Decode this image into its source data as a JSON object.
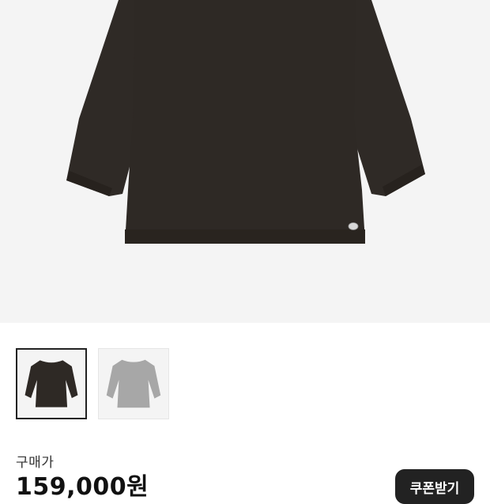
{
  "product": {
    "images": [
      {
        "name": "sweater-dress-brown",
        "color": "#2e2925",
        "selected": true
      },
      {
        "name": "sweater-dress-grey",
        "color": "#a7a7a7",
        "selected": false
      }
    ]
  },
  "price_section": {
    "label": "구매가",
    "price": "159,000원"
  },
  "coupon_button": {
    "label": "쿠폰받기"
  }
}
